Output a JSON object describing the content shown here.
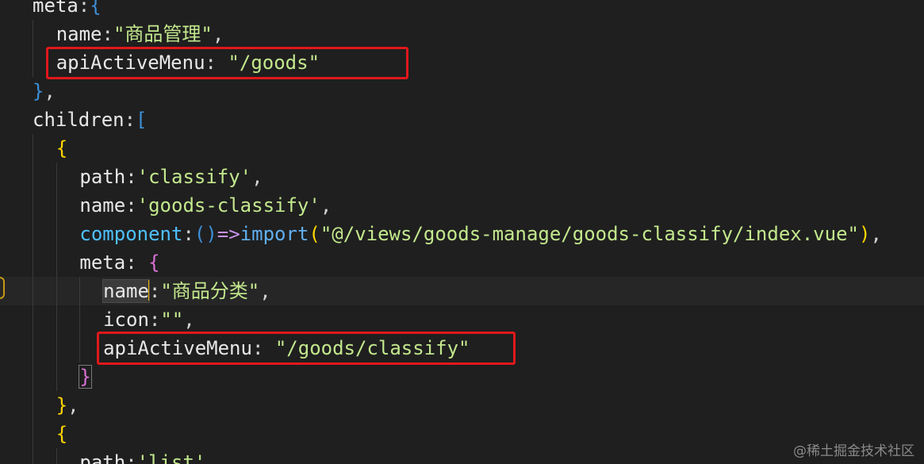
{
  "code_lines": [
    {
      "indent": "",
      "tokens": [
        [
          "meta",
          "k-prop"
        ],
        [
          ":",
          "k-punc"
        ],
        [
          "{",
          "k-brace-1"
        ]
      ]
    },
    {
      "indent": "  ",
      "tokens": [
        [
          "name",
          "k-prop"
        ],
        [
          ":",
          "k-punc"
        ],
        [
          "\"商品管理\"",
          "k-str"
        ],
        [
          ",",
          "k-punc"
        ]
      ]
    },
    {
      "indent": "  ",
      "tokens": [
        [
          "apiActiveMenu",
          "k-prop"
        ],
        [
          ": ",
          "k-punc"
        ],
        [
          "\"/goods\"",
          "k-str"
        ]
      ]
    },
    {
      "indent": "",
      "tokens": [
        [
          "}",
          "k-brace-1"
        ],
        [
          ",",
          "k-punc"
        ]
      ]
    },
    {
      "indent": "",
      "tokens": [
        [
          "children",
          "k-prop"
        ],
        [
          ":",
          "k-punc"
        ],
        [
          "[",
          "k-brace-1"
        ]
      ]
    },
    {
      "indent": "  ",
      "tokens": [
        [
          "{",
          "k-brace-2"
        ]
      ]
    },
    {
      "indent": "    ",
      "tokens": [
        [
          "path",
          "k-prop"
        ],
        [
          ":",
          "k-punc"
        ],
        [
          "'classify'",
          "k-str"
        ],
        [
          ",",
          "k-punc"
        ]
      ]
    },
    {
      "indent": "    ",
      "tokens": [
        [
          "name",
          "k-prop"
        ],
        [
          ":",
          "k-punc"
        ],
        [
          "'goods-classify'",
          "k-str"
        ],
        [
          ",",
          "k-punc"
        ]
      ]
    },
    {
      "indent": "    ",
      "tokens": [
        [
          "component",
          "k-comp"
        ],
        [
          ":",
          "k-punc"
        ],
        [
          "()",
          "k-brace-1"
        ],
        [
          "=>",
          "k-arrow"
        ],
        [
          "import",
          "k-import"
        ],
        [
          "(",
          "k-brace-2"
        ],
        [
          "\"@/views/goods-manage/goods-classify/index.vue\"",
          "k-str"
        ],
        [
          ")",
          "k-brace-2"
        ],
        [
          ",",
          "k-punc"
        ]
      ]
    },
    {
      "indent": "    ",
      "tokens": [
        [
          "meta",
          "k-prop"
        ],
        [
          ": ",
          "k-punc"
        ],
        [
          "{",
          "k-brace-3"
        ]
      ]
    },
    {
      "indent": "      ",
      "tokens": [
        [
          "name",
          "k-prop word-hl"
        ],
        [
          "|CURSOR|",
          "cursor"
        ],
        [
          ":",
          "k-punc"
        ],
        [
          "\"商品分类\"",
          "k-str"
        ],
        [
          ",",
          "k-punc"
        ]
      ]
    },
    {
      "indent": "      ",
      "tokens": [
        [
          "icon",
          "k-prop"
        ],
        [
          ":",
          "k-punc"
        ],
        [
          "\"\"",
          "k-str"
        ],
        [
          ",",
          "k-punc"
        ]
      ]
    },
    {
      "indent": "      ",
      "tokens": [
        [
          "apiActiveMenu",
          "k-prop"
        ],
        [
          ": ",
          "k-punc"
        ],
        [
          "\"/goods/classify\"",
          "k-str"
        ]
      ]
    },
    {
      "indent": "    ",
      "tokens": [
        [
          "}",
          "k-brace-3 brace-match"
        ]
      ]
    },
    {
      "indent": "  ",
      "tokens": [
        [
          "}",
          "k-brace-2"
        ],
        [
          ",",
          "k-punc"
        ]
      ]
    },
    {
      "indent": "  ",
      "tokens": [
        [
          "{",
          "k-brace-2"
        ]
      ]
    },
    {
      "indent": "    ",
      "tokens": [
        [
          "path",
          "k-prop"
        ],
        [
          ":",
          "k-punc"
        ],
        [
          "'list'",
          "k-str"
        ],
        [
          ",",
          "k-punc"
        ]
      ]
    }
  ],
  "current_line_index": 10,
  "watermark": "@稀土掘金技术社区",
  "colors": {
    "background": "#1f1f1f",
    "highlight_box": "#e0181b",
    "string": "#c3e88d",
    "brace_blue": "#3d8fd8",
    "brace_gold": "#ffd700",
    "brace_purple": "#da70d6"
  }
}
